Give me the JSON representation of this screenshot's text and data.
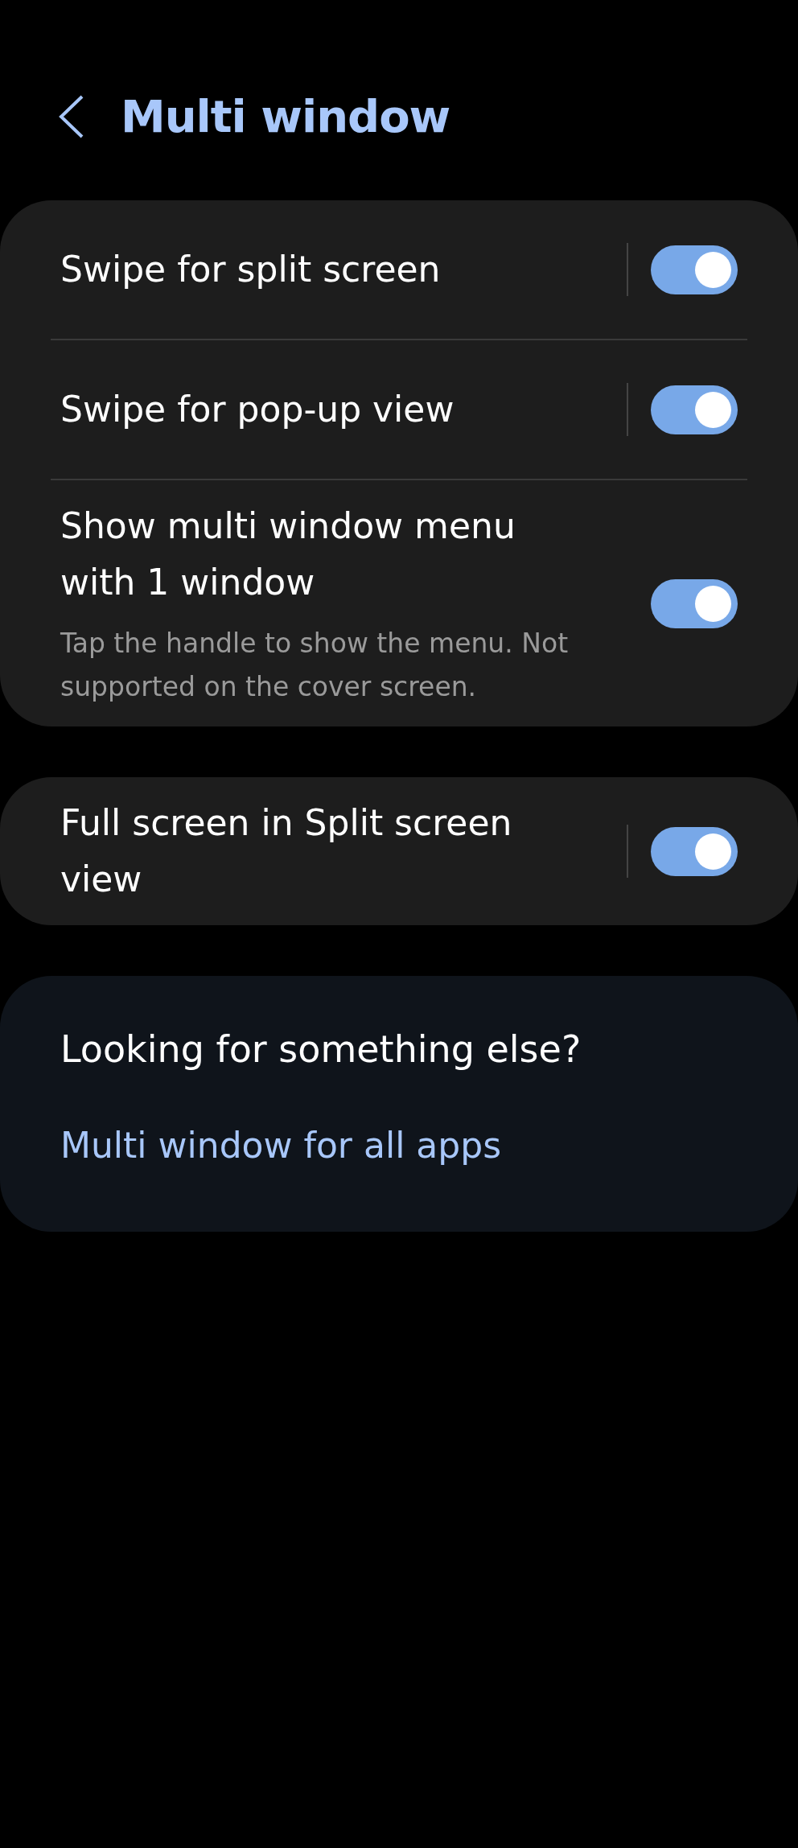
{
  "header": {
    "title": "Multi window"
  },
  "groups": [
    {
      "items": [
        {
          "kind": "split",
          "title": "Swipe for split screen",
          "on": true
        },
        {
          "kind": "split",
          "title": "Swipe for pop-up view",
          "on": true
        },
        {
          "kind": "plain",
          "title": "Show multi window menu with 1 window",
          "subtitle": "Tap the handle to show the menu. Not supported on the cover screen.",
          "on": true
        }
      ]
    },
    {
      "items": [
        {
          "kind": "split",
          "title": "Full screen in Split screen view",
          "on": true
        }
      ]
    }
  ],
  "suggestions": {
    "heading": "Looking for something else?",
    "links": [
      "Multi window for all apps"
    ]
  }
}
